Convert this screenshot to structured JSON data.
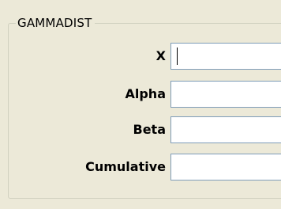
{
  "group": {
    "title": "GAMMADIST"
  },
  "fields": [
    {
      "label": "X",
      "value": ""
    },
    {
      "label": "Alpha",
      "value": ""
    },
    {
      "label": "Beta",
      "value": ""
    },
    {
      "label": "Cumulative",
      "value": ""
    }
  ]
}
